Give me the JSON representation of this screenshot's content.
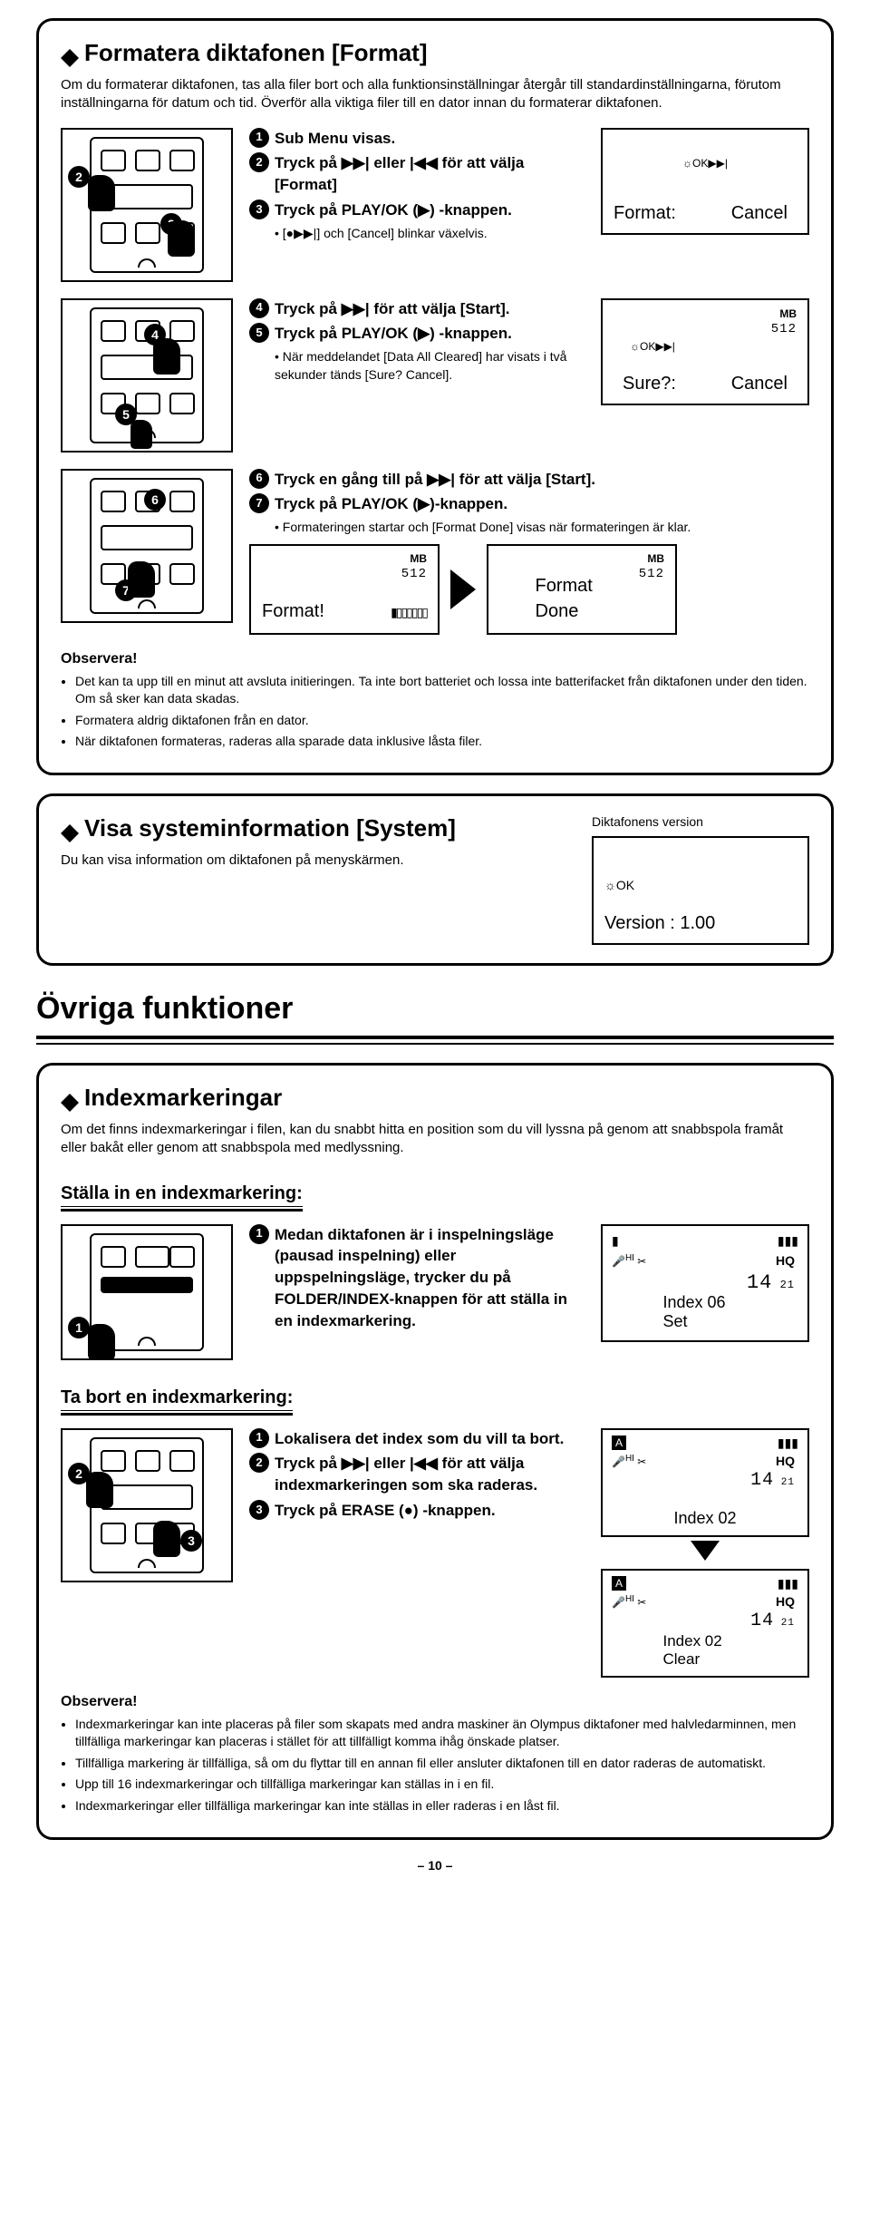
{
  "format_section": {
    "title": "Formatera diktafonen [Format]",
    "intro": "Om du formaterar diktafonen, tas alla filer bort och alla funktionsinställningar återgår till standardinställningarna, förutom inställningarna för datum och tid. Överför alla viktiga filer till en dator innan du formaterar diktafonen.",
    "step1": "Sub Menu visas.",
    "step2": "Tryck på ▶▶| eller |◀◀ för att välja [Format]",
    "step3": "Tryck på PLAY/OK (▶) -knappen.",
    "step3sub": "[●▶▶|] och [Cancel] blinkar växelvis.",
    "lcd1_a": "Format:",
    "lcd1_b": "Cancel",
    "step4": "Tryck på ▶▶| för att välja [Start].",
    "step5": "Tryck på PLAY/OK (▶) -knappen.",
    "step5sub": "När meddelandet [Data All Cleared] har visats i två sekunder tänds [Sure? Cancel].",
    "lcd2_a": "Sure?:",
    "lcd2_b": "Cancel",
    "lcd2_mb": "MB",
    "lcd2_val": "512",
    "step6": "Tryck en gång till på ▶▶| för att välja [Start].",
    "step7": "Tryck på PLAY/OK (▶)-knappen.",
    "step7sub": "Formateringen startar och [Format Done] visas när formateringen är klar.",
    "lcd3_a": "Format!",
    "lcd3_mb": "MB",
    "lcd3_val": "512",
    "lcd4_a": "Format Done",
    "lcd4_mb": "MB",
    "lcd4_val": "512",
    "obs_title": "Observera!",
    "obs1": "Det kan ta upp till en minut att avsluta initieringen. Ta inte bort batteriet och lossa inte batterifacket från diktafonen under den tiden. Om så sker kan data skadas.",
    "obs2": "Formatera aldrig diktafonen från en dator.",
    "obs3": "När diktafonen formateras, raderas alla sparade data inklusive låsta filer."
  },
  "system_section": {
    "title": "Visa systeminformation [System]",
    "intro": "Du kan visa information om diktafonen på menyskärmen.",
    "caption": "Diktafonens version",
    "lcd": "Version : 1.00"
  },
  "other_title": "Övriga funktioner",
  "index_section": {
    "title": "Indexmarkeringar",
    "intro": "Om det finns indexmarkeringar i filen, kan du snabbt hitta en position som du vill lyssna på genom att snabbspola framåt eller bakåt eller genom att snabbspola med medlyssning.",
    "set_head": "Ställa in en indexmarkering:",
    "set_step1": "Medan diktafonen är i inspelningsläge (pausad inspelning) eller uppspelningsläge, trycker du på FOLDER/INDEX-knappen för att ställa in en indexmarkering.",
    "lcd_set_hq": "HQ",
    "lcd_set_time": "14:21",
    "lcd_set_msg": "Index 06 Set",
    "del_head": "Ta bort en indexmarkering:",
    "del_step1": "Lokalisera det index som du vill ta bort.",
    "del_step2": "Tryck på ▶▶| eller |◀◀ för att välja indexmarkeringen som ska raderas.",
    "del_step3": "Tryck på ERASE (●) -knappen.",
    "lcd_del_msg1": "Index 02",
    "lcd_del_msg2": "Index 02 Clear",
    "obs_title": "Observera!",
    "obs1": "Indexmarkeringar kan inte placeras på filer som skapats med andra maskiner än Olympus diktafoner med halvledarminnen, men tillfälliga markeringar kan placeras i stället för att tillfälligt komma ihåg önskade platser.",
    "obs2": "Tillfälliga markering är tillfälliga, så om du flyttar till en annan fil eller ansluter diktafonen till en dator raderas de automatiskt.",
    "obs3": "Upp till 16 indexmarkeringar och tillfälliga markeringar kan ställas in i en fil.",
    "obs4": "Indexmarkeringar eller tillfälliga markeringar kan inte ställas in eller raderas i en låst fil."
  },
  "page_number": "– 10 –"
}
